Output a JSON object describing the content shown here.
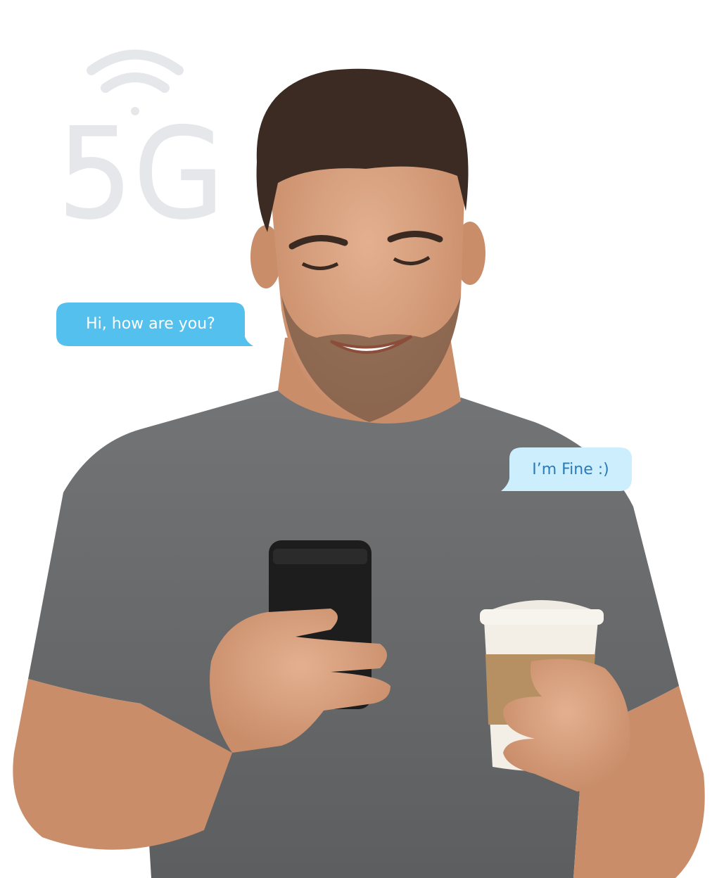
{
  "badge": {
    "label": "5G",
    "icon": "wifi-signal-icon"
  },
  "chat": {
    "incoming": "Hi, how are you?",
    "outgoing": "I’m Fine :)"
  },
  "colors": {
    "incoming_bubble": "#53c0ee",
    "outgoing_bubble": "#cdeefc",
    "outgoing_text": "#2a7bb8",
    "badge_gray": "#e5e7ea",
    "shirt": "#6a6c6e",
    "skin": "#d9a281"
  }
}
